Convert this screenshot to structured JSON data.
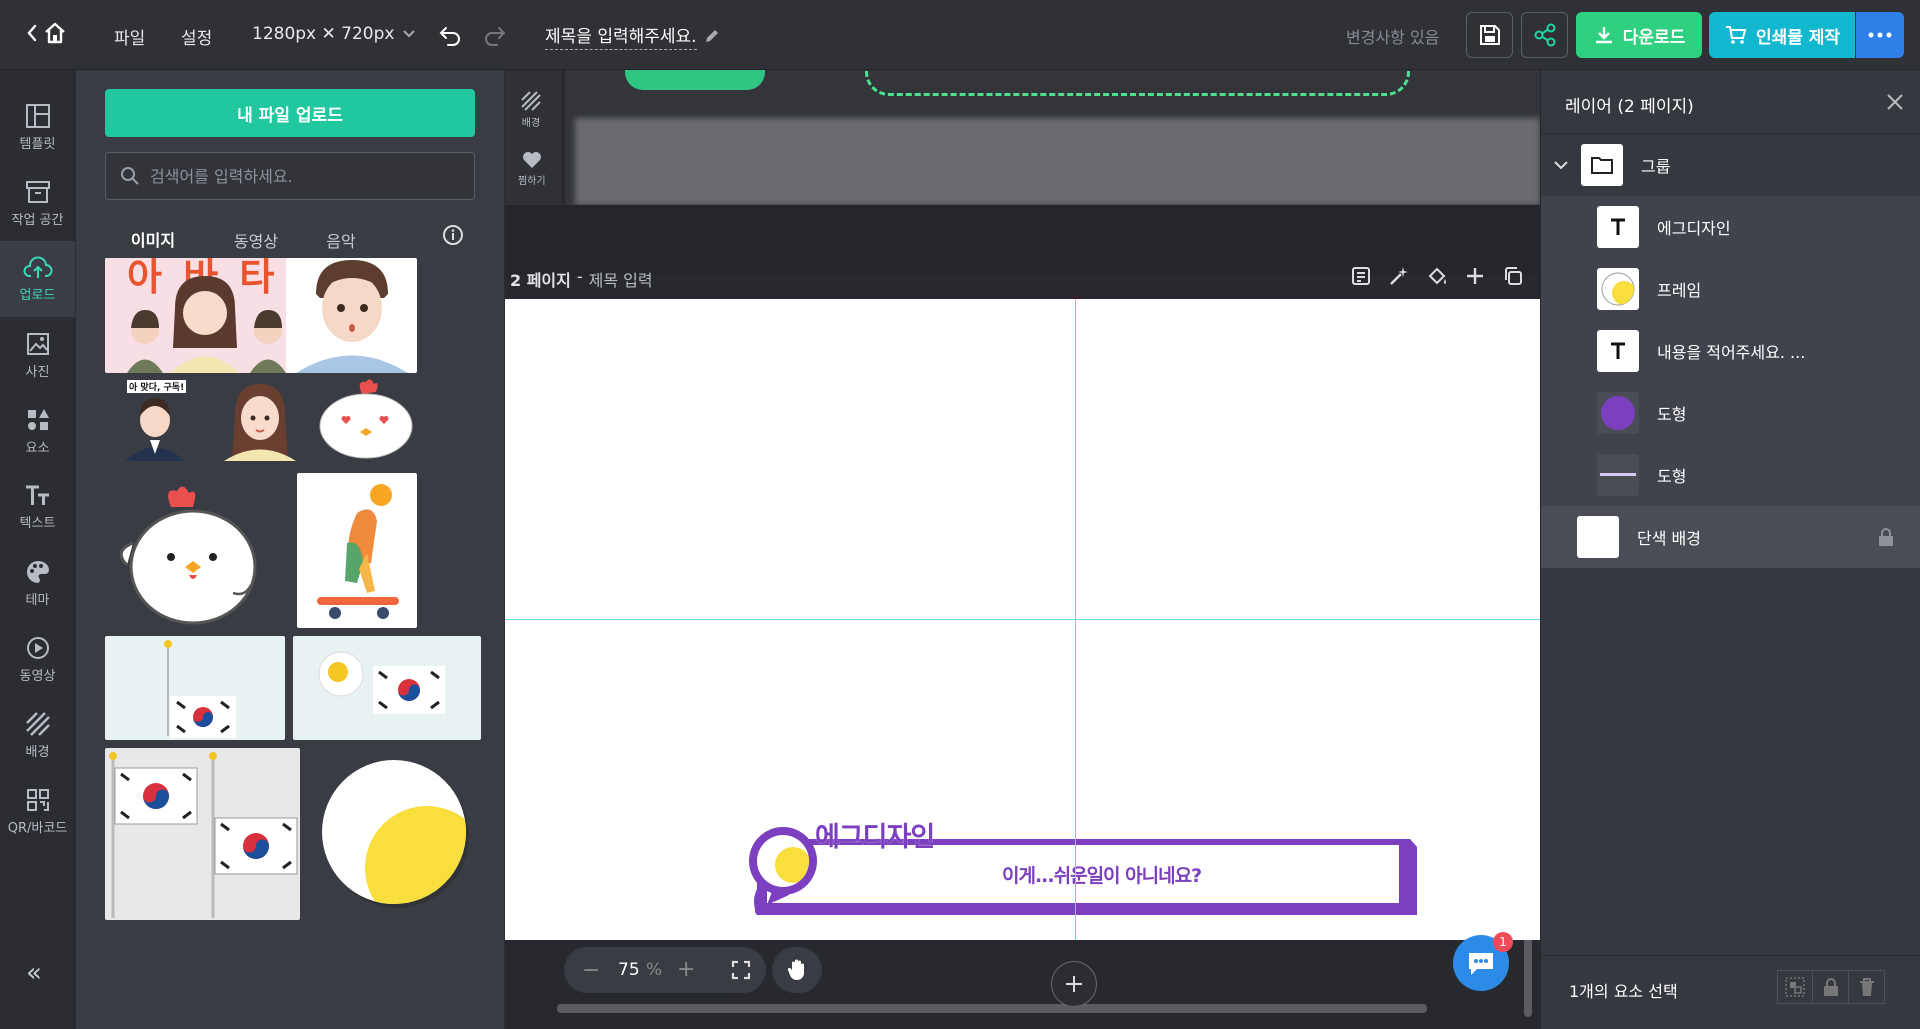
{
  "topbar": {
    "file_menu": "파일",
    "settings_menu": "설정",
    "canvas_size": "1280px ✕ 720px",
    "doc_title": "제목을 입력해주세요.",
    "save_status": "변경사항 있음",
    "download_label": "다운로드",
    "print_label": "인쇄물 제작"
  },
  "rail": {
    "items": [
      {
        "label": "템플릿",
        "icon": "template-icon"
      },
      {
        "label": "작업 공간",
        "icon": "workspace-icon"
      },
      {
        "label": "업로드",
        "icon": "upload-icon"
      },
      {
        "label": "사진",
        "icon": "photo-icon"
      },
      {
        "label": "요소",
        "icon": "elements-icon"
      },
      {
        "label": "텍스트",
        "icon": "text-icon"
      },
      {
        "label": "테마",
        "icon": "palette-icon"
      },
      {
        "label": "동영상",
        "icon": "video-icon"
      },
      {
        "label": "배경",
        "icon": "background-icon"
      },
      {
        "label": "QR/바코드",
        "icon": "qr-icon"
      }
    ],
    "collapse": "«"
  },
  "panel": {
    "upload_button": "내 파일 업로드",
    "search_placeholder": "검색어를 입력하세요.",
    "tabs": [
      "이미지",
      "동영상",
      "음악"
    ],
    "thumb_texts": {
      "banner": "아 바 타",
      "sticker": "아 맞다, 구독!"
    }
  },
  "canvas": {
    "mini_toolbar": {
      "background": "배경",
      "like": "찜하기"
    },
    "page_label": "2 페이지",
    "page_title": "제목 입력",
    "design": {
      "name_text": "에그디자인",
      "body_text": "이게...쉬운일이 아니네요?"
    },
    "zoom_value": "75",
    "zoom_unit": "%",
    "chat_badge": "1"
  },
  "layers": {
    "title": "레이어 (2 페이지)",
    "group_label": "그룹",
    "items": [
      {
        "name": "에그디자인"
      },
      {
        "name": "프레임"
      },
      {
        "name": "내용을 적어주세요. ..."
      },
      {
        "name": "도형"
      },
      {
        "name": "도형"
      }
    ],
    "background_label": "단색 배경",
    "selection_status": "1개의 요소 선택"
  },
  "colors": {
    "accent_green": "#21c79f",
    "download_green": "#2fd07f",
    "print_teal": "#11b8cf",
    "more_blue": "#2f7fe8",
    "design_purple": "#7b3fbf",
    "design_yellow": "#f9df3e"
  }
}
